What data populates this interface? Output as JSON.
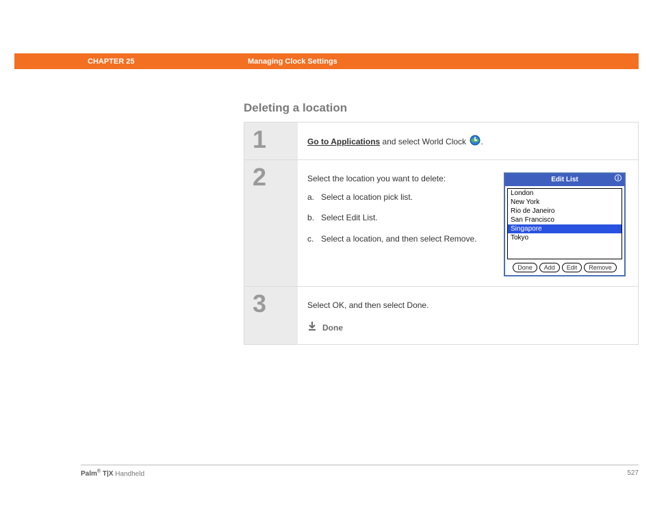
{
  "header": {
    "chapter": "CHAPTER 25",
    "title": "Managing Clock Settings"
  },
  "section_heading": "Deleting a location",
  "steps": {
    "s1": {
      "num": "1",
      "link": "Go to Applications",
      "rest": " and select World Clock "
    },
    "s2": {
      "num": "2",
      "intro": "Select the location you want to delete:",
      "items": {
        "a": {
          "letter": "a.",
          "text": "Select a location pick list."
        },
        "b": {
          "letter": "b.",
          "text": "Select Edit List."
        },
        "c": {
          "letter": "c.",
          "text": "Select a location, and then select Remove."
        }
      }
    },
    "s3": {
      "num": "3",
      "text": "Select OK, and then select Done.",
      "done": "Done"
    }
  },
  "palm": {
    "title": "Edit List",
    "info": "i",
    "items": [
      "London",
      "New York",
      "Rio de Janeiro",
      "San Francisco",
      "Singapore",
      "Tokyo"
    ],
    "selected_index": 4,
    "buttons": {
      "done": "Done",
      "add": "Add",
      "edit": "Edit",
      "remove": "Remove"
    }
  },
  "footer": {
    "brand_prefix": "Palm",
    "reg": "®",
    "brand_mid": " T|X",
    "brand_suffix": " Handheld",
    "page": "527"
  }
}
